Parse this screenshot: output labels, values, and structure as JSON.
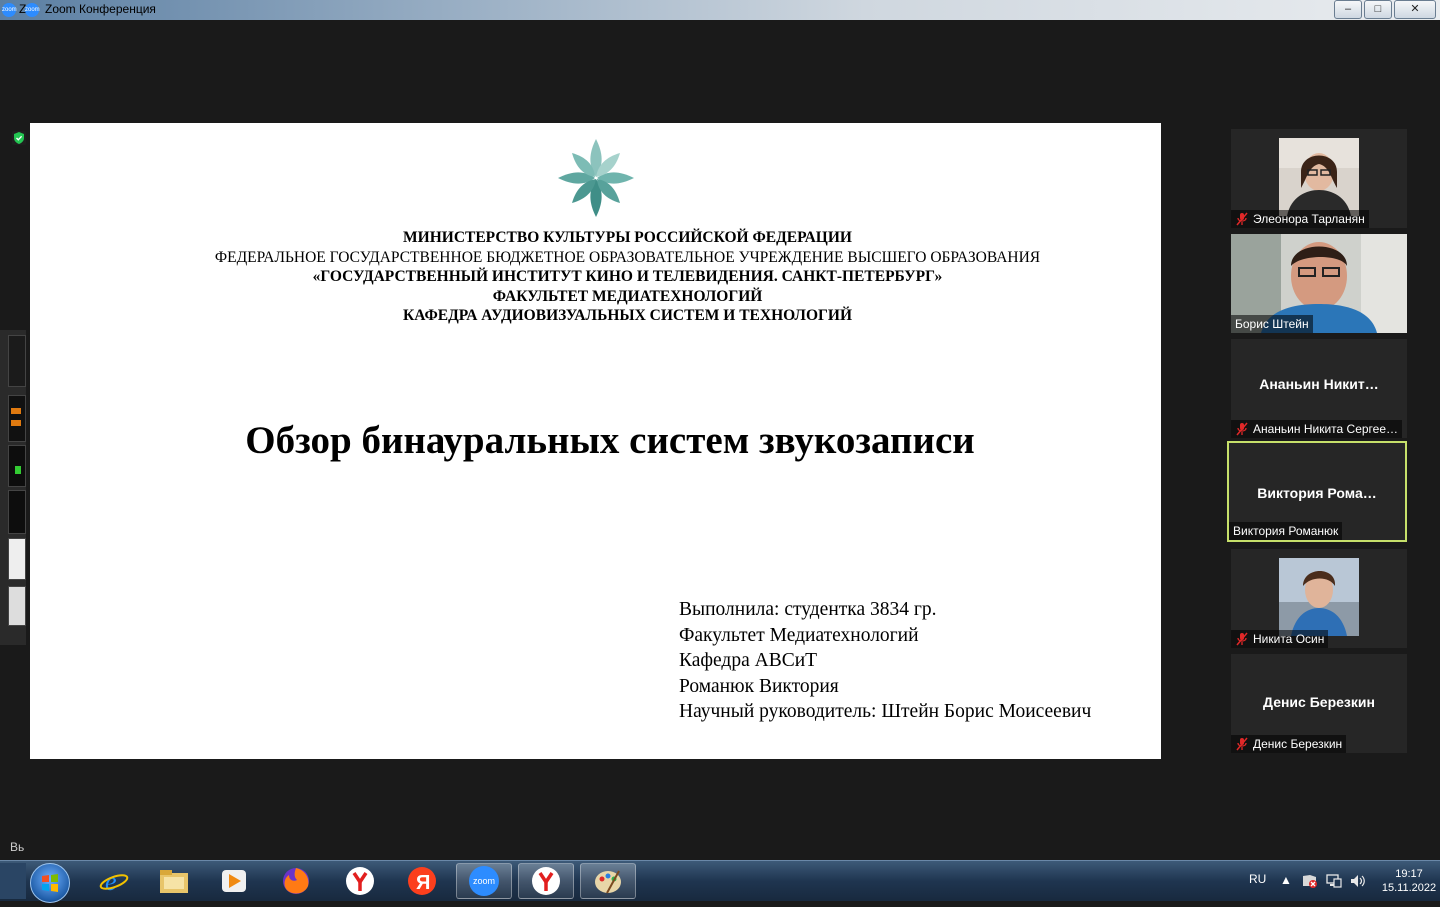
{
  "window": {
    "title": "Zoom Конференция",
    "tab_letter": "Z",
    "zoom_icon_text": "zoom",
    "controls": {
      "minimize": "–",
      "maximize": "□",
      "close": "✕"
    }
  },
  "slide": {
    "header_lines": [
      "МИНИСТЕРСТВО КУЛЬТУРЫ РОССИЙСКОЙ ФЕДЕРАЦИИ",
      "ФЕДЕРАЛЬНОЕ ГОСУДАРСТВЕННОЕ БЮДЖЕТНОЕ ОБРАЗОВАТЕЛЬНОЕ УЧРЕЖДЕНИЕ ВЫСШЕГО ОБРАЗОВАНИЯ",
      "«ГОСУДАРСТВЕННЫЙ ИНСТИТУТ КИНО И ТЕЛЕВИДЕНИЯ. САНКТ-ПЕТЕРБУРГ»",
      "ФАКУЛЬТЕТ МЕДИАТЕХНОЛОГИЙ",
      "КАФЕДРА АУДИОВИЗУАЛЬНЫХ СИСТЕМ И ТЕХНОЛОГИЙ"
    ],
    "title": "Обзор бинауральных систем звукозаписи",
    "info_lines": [
      "Выполнила: студентка 3834 гр.",
      "Факультет Медиатехнологий",
      "Кафедра АВСиТ",
      "Романюк Виктория",
      "Научный руководитель: Штейн Борис Моисеевич"
    ]
  },
  "participants": [
    {
      "name": "Элеонора Тарланян",
      "muted": true,
      "video": true
    },
    {
      "name": "Борис Штейн",
      "muted": false,
      "video": true
    },
    {
      "display": "Ананьин  Никит…",
      "name": "Ананьин Никита Сергее…",
      "muted": true,
      "video": false
    },
    {
      "display": "Виктория   Рома…",
      "name": "Виктория Романюк",
      "muted": false,
      "video": false,
      "active_speaker": true
    },
    {
      "name": "Никита Осин",
      "muted": true,
      "video": true
    },
    {
      "display": "Денис Березкин",
      "name": "Денис Березкин",
      "muted": true,
      "video": false
    }
  ],
  "bottom_left_text": "Вь",
  "taskbar": {
    "apps": [
      "ie-icon",
      "explorer-icon",
      "media-player-icon",
      "firefox-icon",
      "yandex-browser-icon",
      "yandex-icon",
      "zoom-icon",
      "yandex-browser-icon-2",
      "paint-icon"
    ],
    "zoom_label": "zoom",
    "lang": "RU",
    "time": "19:17",
    "date": "15.11.2022"
  },
  "colors": {
    "active_border": "#c6e06a",
    "logo_teal": "#5fa7a0",
    "zoom_blue": "#2d8cff",
    "mic_off_red": "#e02828"
  }
}
